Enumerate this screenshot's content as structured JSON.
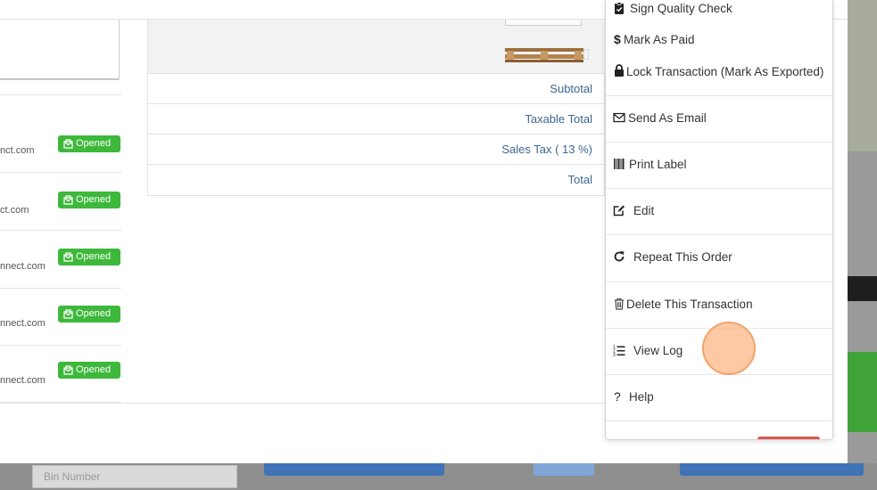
{
  "left_panel": {
    "email_rows": [
      {
        "email": "nct.com",
        "badge": "Opened"
      },
      {
        "email": "ct.com",
        "badge": "Opened"
      },
      {
        "email": "nnect.com",
        "badge": "Opened"
      },
      {
        "email": "nnect.com",
        "badge": "Opened"
      },
      {
        "email": "nnect.com",
        "badge": "Opened"
      }
    ]
  },
  "totals": {
    "subtotal_label": "Subtotal",
    "taxable_total_label": "Taxable Total",
    "sales_tax_label": "Sales Tax ( 13 %)",
    "total_label": "Total"
  },
  "menu": {
    "items": [
      {
        "label": "Sign Quality Check",
        "icon": "clipboard-check-icon"
      },
      {
        "label": "Mark As Paid",
        "icon": "dollar-icon"
      },
      {
        "label": "Lock Transaction (Mark As Exported)",
        "icon": "lock-icon"
      },
      {
        "label": "Send As Email",
        "icon": "envelope-icon"
      },
      {
        "label": "Print Label",
        "icon": "barcode-icon"
      },
      {
        "label": "Edit",
        "icon": "edit-icon"
      },
      {
        "label": "Repeat This Order",
        "icon": "refresh-icon"
      },
      {
        "label": "Delete This Transaction",
        "icon": "trash-icon"
      },
      {
        "label": "View Log",
        "icon": "ordered-list-icon"
      },
      {
        "label": "Help",
        "icon": "question-icon"
      }
    ]
  },
  "background": {
    "search_placeholder": "Bin Number"
  },
  "colors": {
    "badge_green": "#3db83a",
    "link_blue": "#3d6593",
    "cursor_orange": "#fcb787"
  }
}
